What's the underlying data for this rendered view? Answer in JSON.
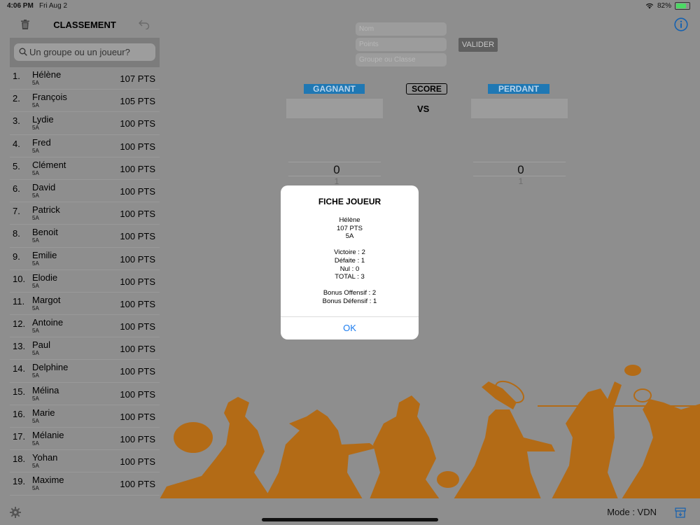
{
  "status": {
    "time": "4:06 PM",
    "date": "Fri Aug 2",
    "battery": "82%",
    "battery_level": 0.82
  },
  "sidebar": {
    "title": "CLASSEMENT",
    "search_placeholder": "Un groupe ou un joueur?",
    "players": [
      {
        "rank": "1.",
        "name": "Hélène",
        "class": "5A",
        "points": "107 PTS"
      },
      {
        "rank": "2.",
        "name": "François",
        "class": "5A",
        "points": "105 PTS"
      },
      {
        "rank": "3.",
        "name": "Lydie",
        "class": "5A",
        "points": "100 PTS"
      },
      {
        "rank": "4.",
        "name": "Fred",
        "class": "5A",
        "points": "100 PTS"
      },
      {
        "rank": "5.",
        "name": "Clément",
        "class": "5A",
        "points": "100 PTS"
      },
      {
        "rank": "6.",
        "name": "David",
        "class": "5A",
        "points": "100 PTS"
      },
      {
        "rank": "7.",
        "name": "Patrick",
        "class": "5A",
        "points": "100 PTS"
      },
      {
        "rank": "8.",
        "name": "Benoit",
        "class": "5A",
        "points": "100 PTS"
      },
      {
        "rank": "9.",
        "name": "Emilie",
        "class": "5A",
        "points": "100 PTS"
      },
      {
        "rank": "10.",
        "name": "Elodie",
        "class": "5A",
        "points": "100 PTS"
      },
      {
        "rank": "11.",
        "name": "Margot",
        "class": "5A",
        "points": "100 PTS"
      },
      {
        "rank": "12.",
        "name": "Antoine",
        "class": "5A",
        "points": "100 PTS"
      },
      {
        "rank": "13.",
        "name": "Paul",
        "class": "5A",
        "points": "100 PTS"
      },
      {
        "rank": "14.",
        "name": "Delphine",
        "class": "5A",
        "points": "100 PTS"
      },
      {
        "rank": "15.",
        "name": "Mélina",
        "class": "5A",
        "points": "100 PTS"
      },
      {
        "rank": "16.",
        "name": "Marie",
        "class": "5A",
        "points": "100 PTS"
      },
      {
        "rank": "17.",
        "name": "Mélanie",
        "class": "5A",
        "points": "100 PTS"
      },
      {
        "rank": "18.",
        "name": "Yohan",
        "class": "5A",
        "points": "100 PTS"
      },
      {
        "rank": "19.",
        "name": "Maxime",
        "class": "5A",
        "points": "100 PTS"
      }
    ]
  },
  "form": {
    "name_placeholder": "Nom",
    "points_placeholder": "Points",
    "group_placeholder": "Groupe ou Classe",
    "validate_label": "VALIDER"
  },
  "match": {
    "winner_label": "GAGNANT",
    "score_label": "SCORE",
    "loser_label": "PERDANT",
    "vs_label": "VS",
    "winner_score": "0",
    "winner_next": "1",
    "loser_score": "0",
    "loser_next": "1"
  },
  "modal": {
    "title": "FICHE JOUEUR",
    "name": "Hélène",
    "points": "107 PTS",
    "class": "5A",
    "victories": "Victoire : 2",
    "defeats": "Défaite : 1",
    "draws": "Nul : 0",
    "total": "TOTAL : 3",
    "bonus_off": "Bonus Offensif : 2",
    "bonus_def": "Bonus Défensif : 1",
    "ok_label": "OK"
  },
  "bottom": {
    "mode": "Mode : VDN"
  },
  "colors": {
    "accent": "#1f78b4",
    "link": "#1a7cf0",
    "silhouette": "#b36b16",
    "overlay": "#8e8e8e"
  },
  "icons": [
    "trash-icon",
    "undo-icon",
    "search-icon",
    "info-icon",
    "gear-icon",
    "archive-icon",
    "wifi-icon",
    "battery-icon"
  ]
}
